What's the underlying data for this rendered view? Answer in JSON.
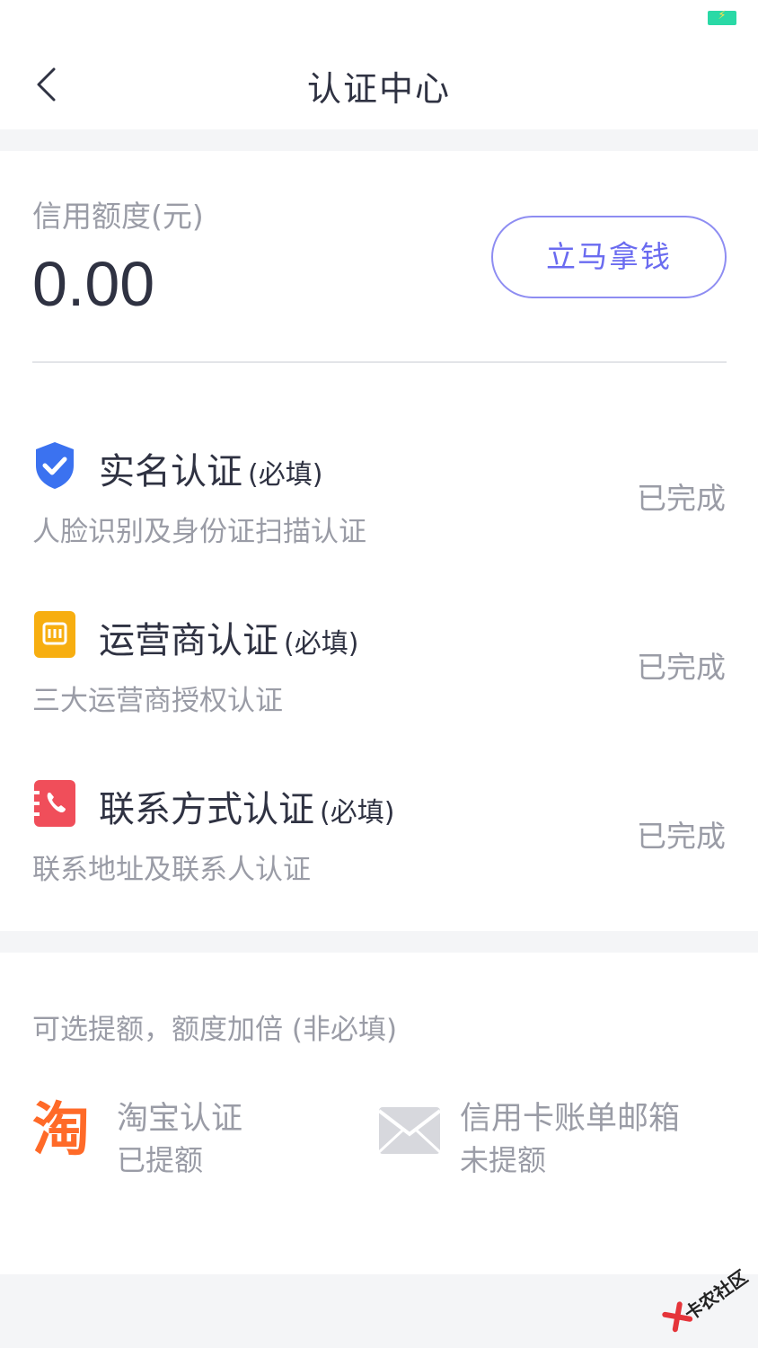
{
  "header": {
    "title": "认证中心"
  },
  "credit": {
    "label": "信用额度(元)",
    "value": "0.00",
    "cta_label": "立马拿钱"
  },
  "auth_items": [
    {
      "title": "实名认证",
      "tag": "(必填)",
      "desc": "人脸识别及身份证扫描认证",
      "status": "已完成",
      "icon": "shield-check-icon",
      "color": "#3b72f0"
    },
    {
      "title": "运营商认证",
      "tag": "(必填)",
      "desc": "三大运营商授权认证",
      "status": "已完成",
      "icon": "sim-card-icon",
      "color": "#f7ae10"
    },
    {
      "title": "联系方式认证",
      "tag": "(必填)",
      "desc": "联系地址及联系人认证",
      "status": "已完成",
      "icon": "phone-book-icon",
      "color": "#f04e5a"
    }
  ],
  "optional": {
    "title": "可选提额，额度加倍 (非必填)",
    "items": [
      {
        "name": "淘宝认证",
        "status": "已提额",
        "icon": "taobao-icon",
        "glyph": "淘",
        "color": "#ff6a28"
      },
      {
        "name": "信用卡账单邮箱",
        "status": "未提额",
        "icon": "mail-icon",
        "color": "#d7d8dd"
      }
    ]
  },
  "watermark": {
    "text": "卡农社区"
  }
}
